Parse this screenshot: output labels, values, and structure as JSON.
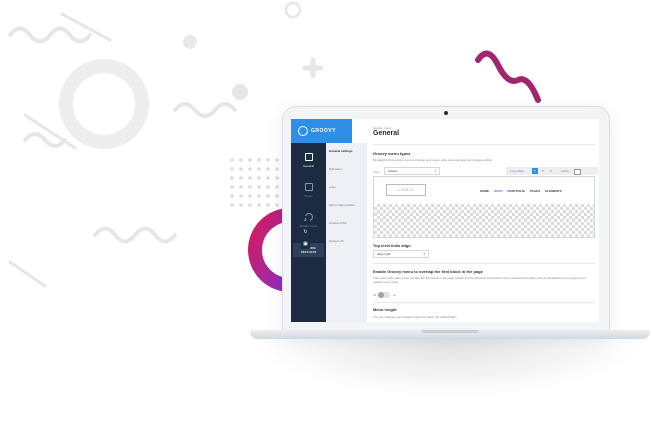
{
  "colors": {
    "brand": "#2f8fe6",
    "sidebar": "#1a2b42",
    "accent_purple": "#a64ee0",
    "swirl": "#a0266f",
    "decor_grey": "#e6e6e6"
  },
  "brand": {
    "name": "GROOVY",
    "icon": "groovy-logo-icon"
  },
  "nav": [
    {
      "label": "General",
      "icon": "sliders-icon",
      "active": true
    },
    {
      "label": "Styles",
      "icon": "layers-icon",
      "active": false
    },
    {
      "label": "Mobile menu",
      "icon": "power-icon",
      "active": false
    }
  ],
  "restore_button": {
    "line1": "RESTORE",
    "line2": "DEFAULTS"
  },
  "subnav": [
    {
      "label": "General settings",
      "active": true
    },
    {
      "label": "Submenu",
      "active": false
    },
    {
      "label": "Logo",
      "active": false
    },
    {
      "label": "Menu main position",
      "active": false
    },
    {
      "label": "Custom CSS",
      "active": false
    },
    {
      "label": "Custom JS",
      "active": false
    }
  ],
  "header": {
    "breadcrumb": "Section menu",
    "title": "General"
  },
  "menu_types": {
    "heading": "Groovy menu types",
    "description": "By applying this option you can choose your menu style elements align and toggle toolbar",
    "type_label": "Type",
    "type_value": "Classic",
    "toolbar": {
      "logo_align_label": "Logo Align",
      "sticky_label": "Sticky"
    }
  },
  "preview": {
    "logo_text": "LOGO",
    "menu_items": [
      {
        "label": "HOME",
        "active": false
      },
      {
        "label": "SHOP",
        "active": true
      },
      {
        "label": "PORTFOLIO",
        "active": false
      },
      {
        "label": "PAGES",
        "active": false
      },
      {
        "label": "ELEMENTS",
        "active": false
      }
    ]
  },
  "links_align": {
    "heading": "Top level links align",
    "value": "Align right"
  },
  "overlap": {
    "heading": "Enable Groovy menu to overlap the first block in the page",
    "description": "This option will make menu overlap the first block in the page (useful if it has absolute transparent menu presets with sliders and in standalone menu types or for mobile menu view)",
    "off_label": "off",
    "on_label": "on"
  },
  "menu_height": {
    "heading": "Menu height",
    "description": "You can change menu height using this option. By default 80px"
  },
  "side_tools": [
    {
      "icon": "search-icon",
      "glyph": "⌕"
    },
    {
      "icon": "refresh-icon",
      "glyph": "↻"
    },
    {
      "icon": "save-icon",
      "glyph": "▣"
    }
  ]
}
